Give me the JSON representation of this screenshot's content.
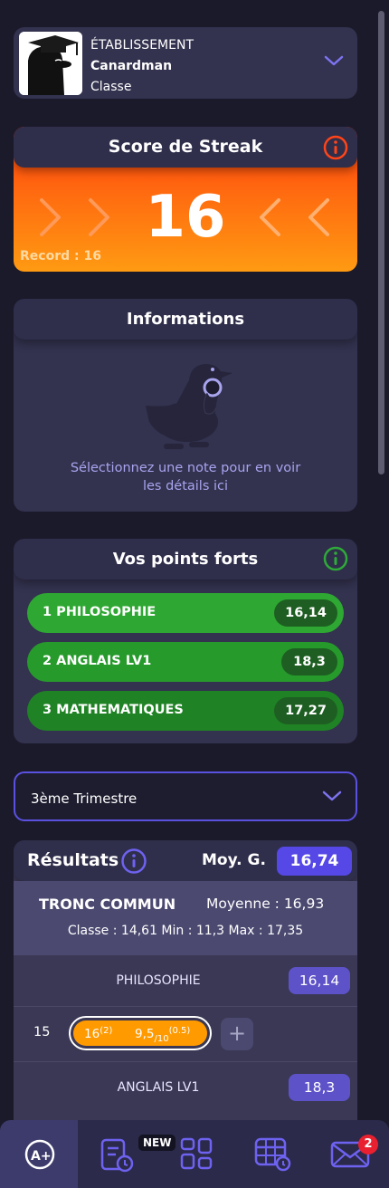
{
  "account": {
    "school_label": "ÉTABLISSEMENT",
    "name": "Canardman",
    "class_label": "Classe"
  },
  "streak": {
    "title": "Score de Streak",
    "value": "16",
    "record": "Record : 16"
  },
  "informations": {
    "title": "Informations",
    "message_line1": "Sélectionnez une note pour en voir",
    "message_line2": "les détails ici"
  },
  "points_forts": {
    "title": "Vos points forts",
    "items": [
      {
        "label": "1  PHILOSOPHIE",
        "score": "16,14",
        "color": "#2ea832"
      },
      {
        "label": "2  ANGLAIS LV1",
        "score": "18,3",
        "color": "#279a2c"
      },
      {
        "label": "3  MATHEMATIQUES",
        "score": "17,27",
        "color": "#1f8325"
      }
    ]
  },
  "period_select": {
    "value": "3ème Trimestre"
  },
  "results": {
    "title": "Résultats",
    "moy_label": "Moy. G.",
    "moy_value": "16,74",
    "tronc": {
      "name": "TRONC COMMUN",
      "moyenne": "Moyenne : 16,93",
      "stats": "Classe : 14,61  Min : 11,3  Max : 17,35"
    },
    "subjects": [
      {
        "name": "PHILOSOPHIE",
        "average": "16,14"
      },
      {
        "name": "ANGLAIS LV1",
        "average": "18,3"
      }
    ],
    "grades_row": {
      "coef": "15",
      "grade1": "16",
      "grade1_coef": "(2)",
      "grade2": "9,5",
      "grade2_scale": "/10",
      "grade2_coef": "(0.5)",
      "add": "+"
    }
  },
  "nav": {
    "new_badge": "NEW",
    "messages_count": "2"
  },
  "colors": {
    "accent": "#5548e6",
    "card": "#33324f",
    "background": "#1b1a2b",
    "streak_orange": "#ff6a10"
  }
}
